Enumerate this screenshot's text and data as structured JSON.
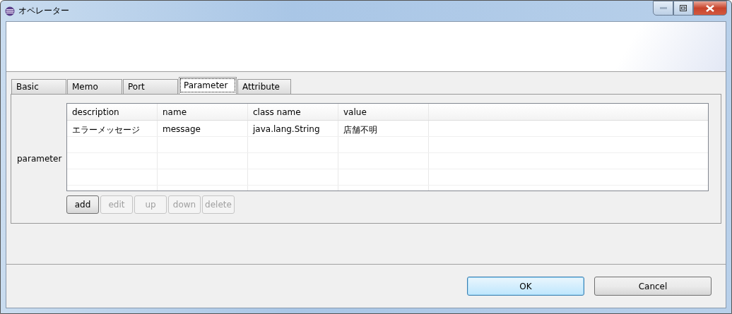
{
  "window": {
    "title": "オペレーター"
  },
  "tabs": [
    {
      "label": "Basic",
      "selected": false
    },
    {
      "label": "Memo",
      "selected": false
    },
    {
      "label": "Port",
      "selected": false
    },
    {
      "label": "Parameter",
      "selected": true
    },
    {
      "label": "Attribute",
      "selected": false
    }
  ],
  "parameter": {
    "label": "parameter",
    "table": {
      "columns": [
        "description",
        "name",
        "class name",
        "value"
      ],
      "rows": [
        [
          "エラーメッセージ",
          "message",
          "java.lang.String",
          "店舗不明"
        ]
      ]
    },
    "buttons": [
      {
        "label": "add",
        "disabled": false
      },
      {
        "label": "edit",
        "disabled": true
      },
      {
        "label": "up",
        "disabled": true
      },
      {
        "label": "down",
        "disabled": true
      },
      {
        "label": "delete",
        "disabled": true
      }
    ]
  },
  "dialog_buttons": [
    {
      "label": "OK",
      "default": true
    },
    {
      "label": "Cancel",
      "default": false
    }
  ]
}
